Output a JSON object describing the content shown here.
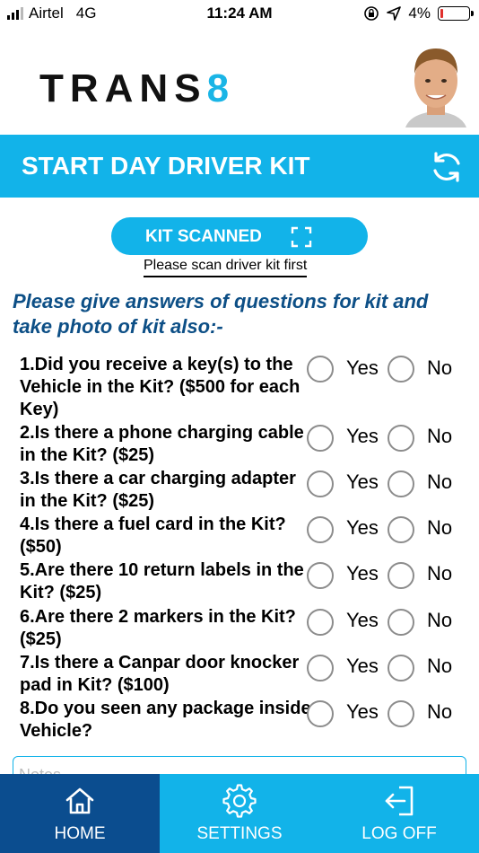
{
  "status_bar": {
    "carrier": "Airtel",
    "network": "4G",
    "time": "11:24 AM",
    "battery": "4%",
    "battery_level": 0.04
  },
  "header": {
    "logo_main": "TRANS",
    "logo_accent": "8",
    "avatar_icon": "user-avatar"
  },
  "title_bar": {
    "title": "START DAY DRIVER KIT",
    "refresh_icon": "refresh-icon"
  },
  "kit": {
    "button_label": "KIT SCANNED",
    "note": "Please scan driver kit first"
  },
  "instructions": "Please give answers of questions for kit and take photo of kit also:-",
  "options": {
    "yes": "Yes",
    "no": "No"
  },
  "questions": [
    {
      "text": "1.Did you receive a key(s) to the Vehicle in the Kit? ($500 for each Key)"
    },
    {
      "text": "2.Is there a phone charging cable in the Kit? ($25)"
    },
    {
      "text": "3.Is there a car charging adapter in the Kit? ($25)"
    },
    {
      "text": "4.Is there a fuel card in the Kit? ($50)"
    },
    {
      "text": "5.Are there 10 return labels in the Kit? ($25)"
    },
    {
      "text": "6.Are there 2 markers in the Kit? ($25)"
    },
    {
      "text": "7.Is there a Canpar door knocker pad in Kit? ($100)"
    },
    {
      "text": "8.Do you seen any package inside Vehicle?"
    }
  ],
  "notes": {
    "placeholder": "Notes"
  },
  "tabs": [
    {
      "label": "HOME",
      "icon": "home-icon"
    },
    {
      "label": "SETTINGS",
      "icon": "gear-icon"
    },
    {
      "label": "LOG OFF",
      "icon": "logout-icon"
    }
  ],
  "colors": {
    "accent": "#12b3e9",
    "navy": "#0b4d8f",
    "instruction_text": "#0d4f86"
  }
}
